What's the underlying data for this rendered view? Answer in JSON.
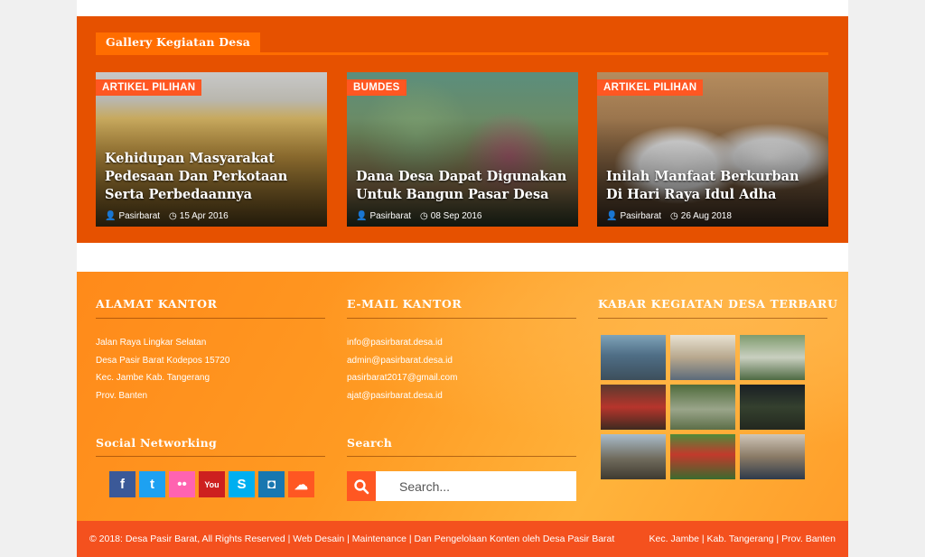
{
  "gallery": {
    "heading": "Gallery Kegiatan Desa",
    "cards": [
      {
        "tag": "ARTIKEL PILIHAN",
        "title": "Kehidupan Masyarakat Pedesaan Dan Perkotaan Serta Perbedaannya",
        "author": "Pasirbarat",
        "date": "15 Apr 2016"
      },
      {
        "tag": "BUMDES",
        "title": "Dana Desa Dapat Digunakan Untuk Bangun Pasar Desa",
        "author": "Pasirbarat",
        "date": "08 Sep 2016"
      },
      {
        "tag": "ARTIKEL PILIHAN",
        "title": "Inilah Manfaat Berkurban Di Hari Raya Idul Adha",
        "author": "Pasirbarat",
        "date": "26 Aug 2018"
      }
    ]
  },
  "footer": {
    "address": {
      "title": "ALAMAT KANTOR",
      "lines": [
        "Jalan Raya Lingkar Selatan",
        "Desa Pasir Barat Kodepos 15720",
        "Kec. Jambe Kab. Tangerang",
        "Prov. Banten"
      ]
    },
    "email": {
      "title": "E-MAIL KANTOR",
      "lines": [
        "info@pasirbarat.desa.id",
        "admin@pasirbarat.desa.id",
        "pasirbarat2017@gmail.com",
        "ajat@pasirbarat.desa.id"
      ]
    },
    "news": {
      "title": "KABAR KEGIATAN DESA TERBARU"
    },
    "social": {
      "title": "Social Networking",
      "items": [
        {
          "name": "facebook",
          "glyph": "f",
          "color": "#3b5998"
        },
        {
          "name": "twitter",
          "glyph": "t",
          "color": "#1da1f2"
        },
        {
          "name": "flickr",
          "glyph": "••",
          "color": "#ff63b0"
        },
        {
          "name": "youtube",
          "glyph": "You",
          "color": "#cd201f"
        },
        {
          "name": "skype",
          "glyph": "S",
          "color": "#00aff0"
        },
        {
          "name": "instagram",
          "glyph": "◘",
          "color": "#1877b0"
        },
        {
          "name": "soundcloud",
          "glyph": "☁",
          "color": "#ff5722"
        }
      ]
    },
    "search": {
      "title": "Search",
      "placeholder": "Search..."
    }
  },
  "copyright": {
    "left": "© 2018: Desa Pasir Barat, All Rights Reserved | Web Desain | Maintenance | Dan Pengelolaan Konten oleh Desa Pasir Barat",
    "right": "Kec. Jambe | Kab. Tangerang | Prov. Banten"
  },
  "colors": {
    "gallery_bg": "#e65100",
    "accent": "#ff5722",
    "footer_orange": "#ff9a22",
    "copyright_bg": "#f4511e"
  }
}
